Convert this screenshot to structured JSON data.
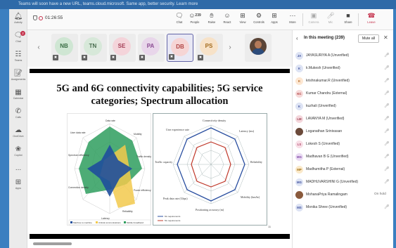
{
  "os_bar": {
    "text": "Teams will soon have a new URL, teams.cloud.microsoft. Same app, better security. Learn more"
  },
  "rail": {
    "items": [
      {
        "label": "Activity",
        "icon": "bell-icon"
      },
      {
        "label": "Chat",
        "icon": "chat-icon",
        "badge": "2"
      },
      {
        "label": "Teams",
        "icon": "teams-icon"
      },
      {
        "label": "Assignments",
        "icon": "assignments-icon"
      },
      {
        "label": "Calendar",
        "icon": "calendar-icon"
      },
      {
        "label": "Calls",
        "icon": "phone-icon"
      },
      {
        "label": "OneDrive",
        "icon": "cloud-icon"
      },
      {
        "label": "Copilot",
        "icon": "copilot-icon"
      },
      {
        "label": "...",
        "icon": "more-icon"
      },
      {
        "label": "Apps",
        "icon": "apps-icon"
      }
    ]
  },
  "toolbar": {
    "timer": "01:26:55",
    "people_count": "239",
    "buttons": {
      "chat": "Chat",
      "people": "People",
      "raise": "Raise",
      "react": "React",
      "view": "View",
      "controls": "Controls",
      "apps": "Apps",
      "more": "More",
      "camera": "Camera",
      "mic": "Mic",
      "share": "Share",
      "leave": "Leave"
    }
  },
  "tiles": [
    {
      "initials": "NB",
      "bg": "#cfe6d3",
      "fg": "#3a6e45"
    },
    {
      "initials": "TN",
      "bg": "#d7e8d9",
      "fg": "#466b4c"
    },
    {
      "initials": "SE",
      "bg": "#f4d4da",
      "fg": "#a33d55"
    },
    {
      "initials": "PA",
      "bg": "#e8d6ea",
      "fg": "#8a4a92"
    },
    {
      "initials": "DB",
      "bg": "#f6d5d5",
      "fg": "#b04444"
    },
    {
      "initials": "PS",
      "bg": "#f7e2c8",
      "fg": "#a26a1c"
    }
  ],
  "slide": {
    "title": "5G and 6G connectivity capabilities; 5G service categories; Spectrum allocation",
    "page_number": "11",
    "left_labels": {
      "data_rate": "Data rate",
      "user_rate": "User data rate",
      "mobility": "Mobility",
      "spectrum": "Spectrum efficiency",
      "traffic": "Traffic density",
      "connection": "Connection density",
      "power": "Power efficiency",
      "latency": "Latency",
      "reliability": "Reliability",
      "legend": [
        "Machine to machine",
        "Critical communications",
        "Mobile broadband"
      ]
    },
    "right_labels": {
      "top": "Connectivity density",
      "user_exp": "User experience rate",
      "latency": "Latency (ms)",
      "reliability": "Reliability",
      "traffic": "Traffic capacity",
      "mobility": "Mobility (km/hr)",
      "peak": "Peak data rate (Gbps)",
      "positioning": "Positioning accuracy (m)",
      "legend": [
        "6G requirements",
        "5G requirements"
      ]
    }
  },
  "panel": {
    "title": "In this meeting (239)",
    "mute_all": "Mute all",
    "participants": [
      {
        "initials": "JA",
        "name": "JAYASURIYA A (Unverified)",
        "bg": "#dde3f4",
        "fg": "#3b4d9a"
      },
      {
        "initials": "K",
        "name": "k.Mukesh (Unverified)",
        "bg": "#dde3f4",
        "fg": "#3b4d9a"
      },
      {
        "initials": "K",
        "name": "krishnakumar.R (Unverified)",
        "bg": "#fde7d2",
        "fg": "#b0611b"
      },
      {
        "initials": "KC",
        "name": "Kumar Chandru (External)",
        "bg": "#f6dada",
        "fg": "#a33"
      },
      {
        "initials": "K",
        "name": "kuzhali (Unverified)",
        "bg": "#dde3f4",
        "fg": "#3b4d9a"
      },
      {
        "initials": "LM",
        "name": "LAVANYA M (Unverified)",
        "bg": "#f4d7dc",
        "fg": "#9b3a4d"
      },
      {
        "initials": "",
        "name": "Loganathan Srinivasan",
        "photo": true
      },
      {
        "initials": "LS",
        "name": "Lokesh S (Unverified)",
        "bg": "#f8dfe7",
        "fg": "#b14468"
      },
      {
        "initials": "MG",
        "name": "Madhavan B G (Unverified)",
        "bg": "#eadcf3",
        "fg": "#7b3fa2"
      },
      {
        "initials": "MP",
        "name": "Madhumitha P (External)",
        "bg": "#fbe9c9",
        "fg": "#9a6a10"
      },
      {
        "initials": "MG",
        "name": "MADHUVARSHINI G (Unverified)",
        "bg": "#dde3f4",
        "fg": "#3b4d9a"
      },
      {
        "initials": "",
        "name": "MohanaPriya Ramalingam",
        "photo": true,
        "status": "On hold"
      },
      {
        "initials": "MS",
        "name": "Monika Shree (Unverified)",
        "bg": "#dde3f4",
        "fg": "#3b4d9a"
      }
    ]
  }
}
